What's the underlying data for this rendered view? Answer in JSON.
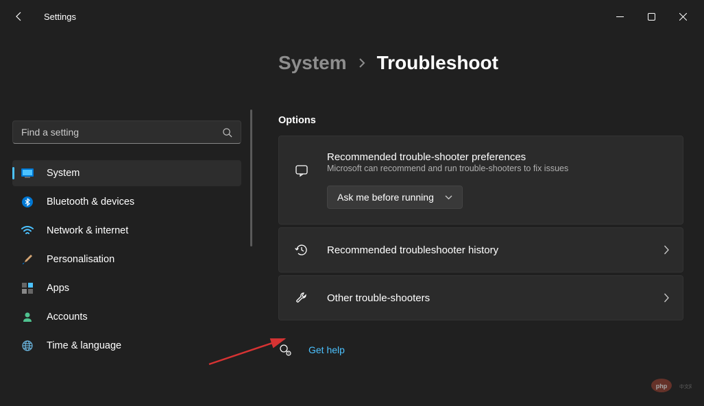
{
  "window": {
    "title": "Settings"
  },
  "search": {
    "placeholder": "Find a setting"
  },
  "sidebar": {
    "items": [
      {
        "label": "System",
        "icon": "system-icon",
        "active": true
      },
      {
        "label": "Bluetooth & devices",
        "icon": "bluetooth-icon"
      },
      {
        "label": "Network & internet",
        "icon": "wifi-icon"
      },
      {
        "label": "Personalisation",
        "icon": "paintbrush-icon"
      },
      {
        "label": "Apps",
        "icon": "apps-icon"
      },
      {
        "label": "Accounts",
        "icon": "accounts-icon"
      },
      {
        "label": "Time & language",
        "icon": "globe-icon"
      }
    ]
  },
  "breadcrumb": {
    "parent": "System",
    "current": "Troubleshoot"
  },
  "section": {
    "title": "Options"
  },
  "cards": {
    "recommended": {
      "title": "Recommended trouble-shooter preferences",
      "subtitle": "Microsoft can recommend and run trouble-shooters to fix issues",
      "dropdown_value": "Ask me before running"
    },
    "history": {
      "title": "Recommended troubleshooter history"
    },
    "other": {
      "title": "Other trouble-shooters"
    }
  },
  "help": {
    "label": "Get help"
  }
}
